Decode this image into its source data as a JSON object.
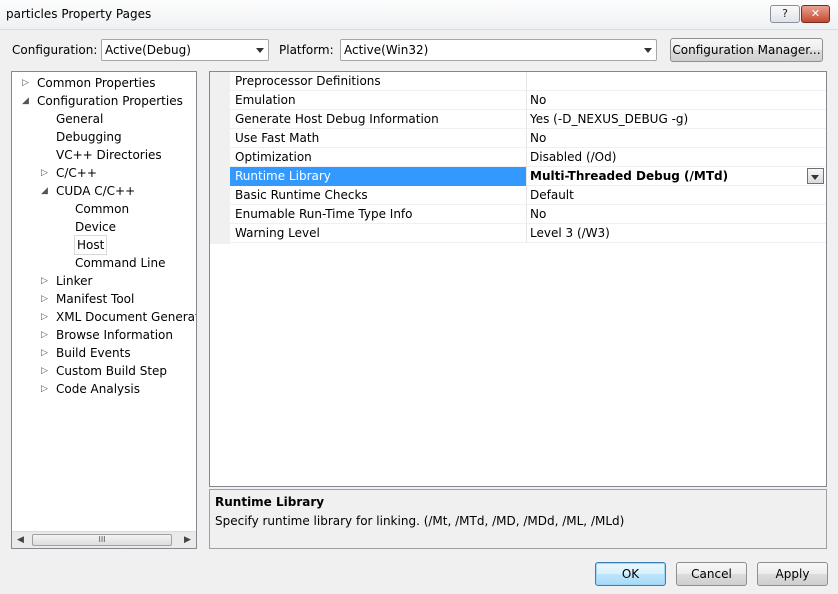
{
  "window": {
    "title": "particles Property Pages",
    "help_label": "?",
    "close_label": "✕"
  },
  "toolbar": {
    "configuration_label": "Configuration:",
    "configuration_value": "Active(Debug)",
    "platform_label": "Platform:",
    "platform_value": "Active(Win32)",
    "config_manager_label": "Configuration Manager..."
  },
  "tree": {
    "items": [
      {
        "label": "Common Properties",
        "expander": "▷"
      },
      {
        "label": "Configuration Properties",
        "expander": "◢"
      },
      {
        "label": "General",
        "expander": ""
      },
      {
        "label": "Debugging",
        "expander": ""
      },
      {
        "label": "VC++ Directories",
        "expander": ""
      },
      {
        "label": "C/C++",
        "expander": "▷"
      },
      {
        "label": "CUDA C/C++",
        "expander": "◢"
      },
      {
        "label": "Common",
        "expander": ""
      },
      {
        "label": "Device",
        "expander": ""
      },
      {
        "label": "Host",
        "expander": ""
      },
      {
        "label": "Command Line",
        "expander": ""
      },
      {
        "label": "Linker",
        "expander": "▷"
      },
      {
        "label": "Manifest Tool",
        "expander": "▷"
      },
      {
        "label": "XML Document Generator",
        "expander": "▷"
      },
      {
        "label": "Browse Information",
        "expander": "▷"
      },
      {
        "label": "Build Events",
        "expander": "▷"
      },
      {
        "label": "Custom Build Step",
        "expander": "▷"
      },
      {
        "label": "Code Analysis",
        "expander": "▷"
      }
    ],
    "selected": "Host",
    "scroll_left": "◀",
    "scroll_right": "▶",
    "scroll_thumb": "III"
  },
  "grid": {
    "rows": [
      {
        "name": "Preprocessor Definitions",
        "value": ""
      },
      {
        "name": "Emulation",
        "value": "No"
      },
      {
        "name": "Generate Host Debug Information",
        "value": "Yes (-D_NEXUS_DEBUG -g)"
      },
      {
        "name": "Use Fast Math",
        "value": "No"
      },
      {
        "name": "Optimization",
        "value": "Disabled (/Od)"
      },
      {
        "name": "Runtime Library",
        "value": "Multi-Threaded Debug (/MTd)"
      },
      {
        "name": "Basic Runtime Checks",
        "value": "Default"
      },
      {
        "name": "Enumable Run-Time Type Info",
        "value": "No"
      },
      {
        "name": "Warning Level",
        "value": "Level 3 (/W3)"
      }
    ],
    "selected": "Runtime Library"
  },
  "description": {
    "title": "Runtime Library",
    "text": "Specify runtime library for linking. (/Mt, /MTd, /MD, /MDd, /ML, /MLd)"
  },
  "buttons": {
    "ok": "OK",
    "cancel": "Cancel",
    "apply": "Apply"
  },
  "colors": {
    "selection": "#3399ff",
    "window_bg": "#f0f0f0"
  }
}
